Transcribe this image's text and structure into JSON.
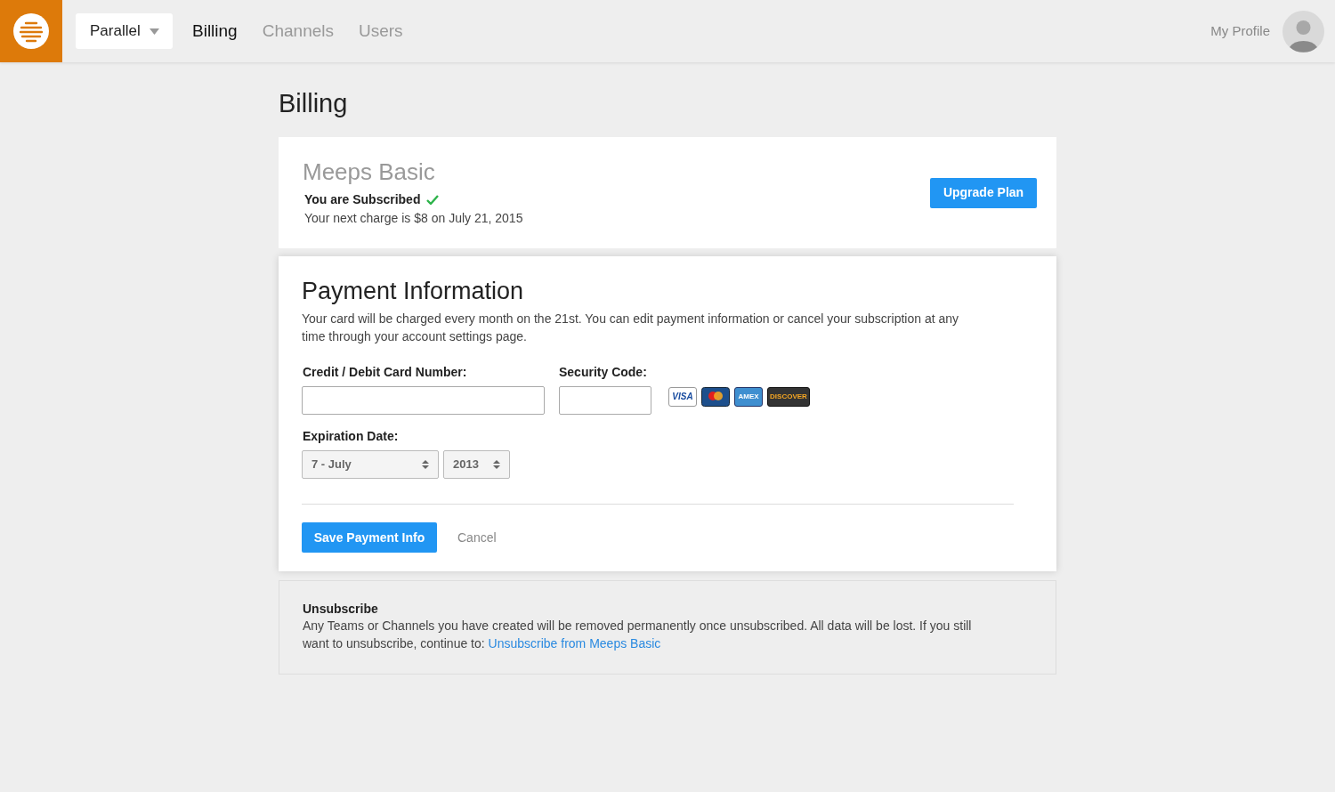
{
  "nav": {
    "workspace": "Parallel",
    "tabs": [
      {
        "label": "Billing",
        "selected": true
      },
      {
        "label": "Channels",
        "selected": false
      },
      {
        "label": "Users",
        "selected": false
      }
    ],
    "profile": "My Profile"
  },
  "page_title": "Billing",
  "plan": {
    "name": "Meeps Basic",
    "status": "You are Subscribed",
    "subscribed": true,
    "next_charge": "Your next charge is $8 on July 21, 2015",
    "button": "Upgrade Plan"
  },
  "payment": {
    "title": "Payment Information",
    "description": "Your card will be charged every month on the 21st. You can edit payment information or cancel your subscription at any time through your account settings page.",
    "card_number": {
      "label": "Credit / Debit Card Number:"
    },
    "security_code": {
      "label": "Security Code:"
    },
    "cards": [
      {
        "kind": "visa",
        "label": "VISA"
      },
      {
        "kind": "mastercard"
      },
      {
        "kind": "amex",
        "label": "AMEX"
      },
      {
        "kind": "discover",
        "label": "DISCOVER"
      }
    ],
    "expiration": {
      "label": "Expiration Date:",
      "month": "7 - July",
      "year": "2013"
    },
    "save_button": "Save Payment Info",
    "cancel": "Cancel"
  },
  "unsubscribe": {
    "title": "Unsubscribe",
    "text": "Any Teams or Channels you have created will be removed permanently once unsubscribed. All data will be lost. If you still want to unsubscribe, continue to:",
    "link": "Unsubscribe from Meeps Basic"
  }
}
